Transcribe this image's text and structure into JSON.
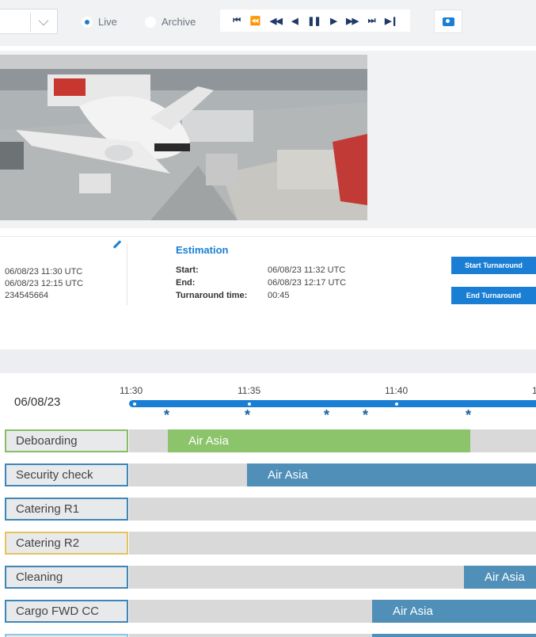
{
  "toolbar": {
    "live_label": "Live",
    "archive_label": "Archive",
    "player_controls": [
      "skip-to-start-icon",
      "fast-rewind-icon",
      "rewind-icon",
      "step-back-icon",
      "pause-icon",
      "play-icon",
      "fast-forward-icon",
      "skip-forward-icon",
      "skip-to-end-icon"
    ],
    "player_glyphs": [
      "⏮",
      "⏪",
      "◀◀",
      "◀",
      "❚❚",
      "▶",
      "▶▶",
      "⏭",
      "▶❙"
    ]
  },
  "info": {
    "left": {
      "start": "06/08/23  11:30 UTC",
      "end": "06/08/23  12:15 UTC",
      "id": "234545664"
    },
    "estimation": {
      "title": "Estimation",
      "start_label": "Start:",
      "start_value": "06/08/23  11:32 UTC",
      "end_label": "End:",
      "end_value": "06/08/23  12:17 UTC",
      "turnaround_label": "Turnaround time:",
      "turnaround_value": "00:45"
    },
    "start_button": "Start Turnaround",
    "end_button": "End Turnaround"
  },
  "timeline": {
    "date": "06/08/23",
    "ticks": [
      "11:30",
      "11:35",
      "11:40",
      "1"
    ],
    "star": "*"
  },
  "rows": [
    {
      "label": "Deboarding",
      "border_color": "#86bf63",
      "bar_label": "Air Asia",
      "bar_color": "#8cc46c"
    },
    {
      "label": "Security check",
      "border_color": "#3f86b8",
      "bar_label": "Air Asia",
      "bar_color": "#4f8fb8"
    },
    {
      "label": "Catering R1",
      "border_color": "#3f86b8",
      "bar_label": "",
      "bar_color": ""
    },
    {
      "label": "Catering R2",
      "border_color": "#e8c35a",
      "bar_label": "",
      "bar_color": ""
    },
    {
      "label": "Cleaning",
      "border_color": "#3f86b8",
      "bar_label": "Air Asia",
      "bar_color": "#4f8fb8"
    },
    {
      "label": "Cargo FWD CC",
      "border_color": "#3f86b8",
      "bar_label": "Air Asia",
      "bar_color": "#4f8fb8"
    }
  ]
}
